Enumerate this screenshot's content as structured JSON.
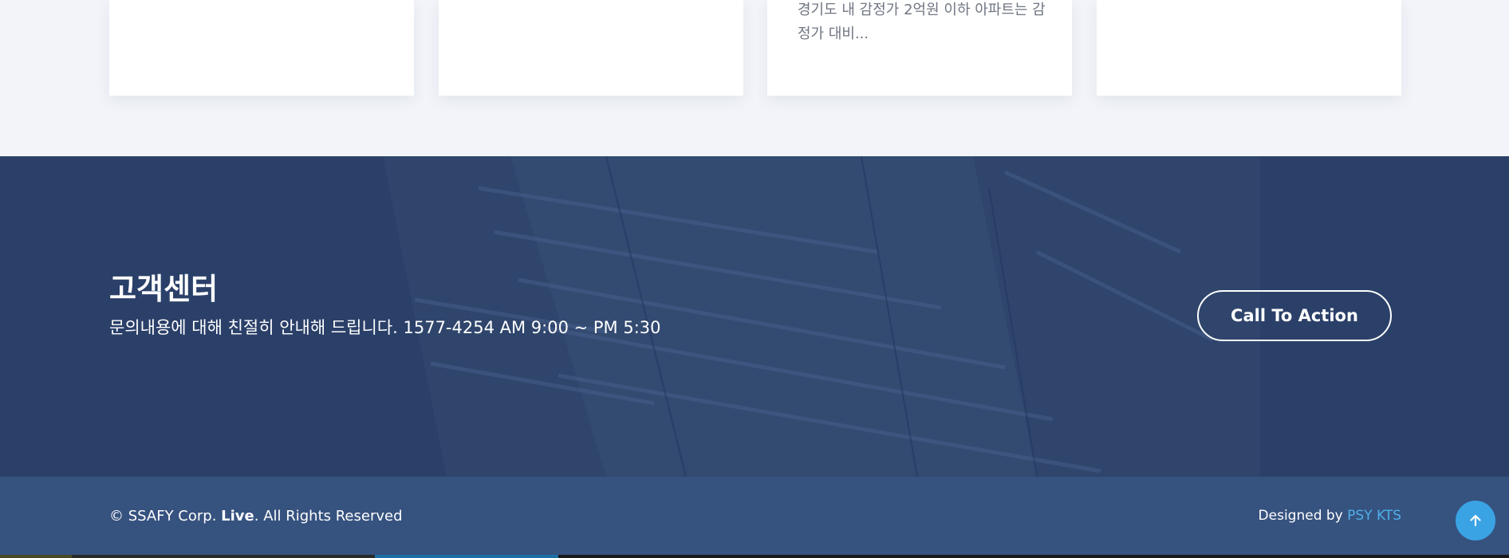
{
  "cards": [
    {
      "excerpt": ""
    },
    {
      "excerpt": ""
    },
    {
      "excerpt": "경기도 내 감정가 2억원 이하 아파트는 감정가 대비..."
    },
    {
      "excerpt": ""
    }
  ],
  "cta": {
    "title": "고객센터",
    "text": "문의내용에 대해 친절히 안내해 드립니다. 1577-4254 AM 9:00 ~ PM 5:30",
    "button_label": "Call To Action"
  },
  "footer": {
    "copyright_prefix": "© SSAFY Corp. ",
    "copyright_brand": "Live",
    "copyright_suffix": ". All Rights Reserved",
    "designed_by_label": "Designed by ",
    "designer_link": "PSY KTS"
  },
  "icons": {
    "back_to_top": "arrow-up-icon"
  },
  "colors": {
    "cta_background": "#2b4069",
    "footer_background": "#36527f",
    "link_accent": "#4fb0ea",
    "back_to_top": "#3aa3e4"
  }
}
